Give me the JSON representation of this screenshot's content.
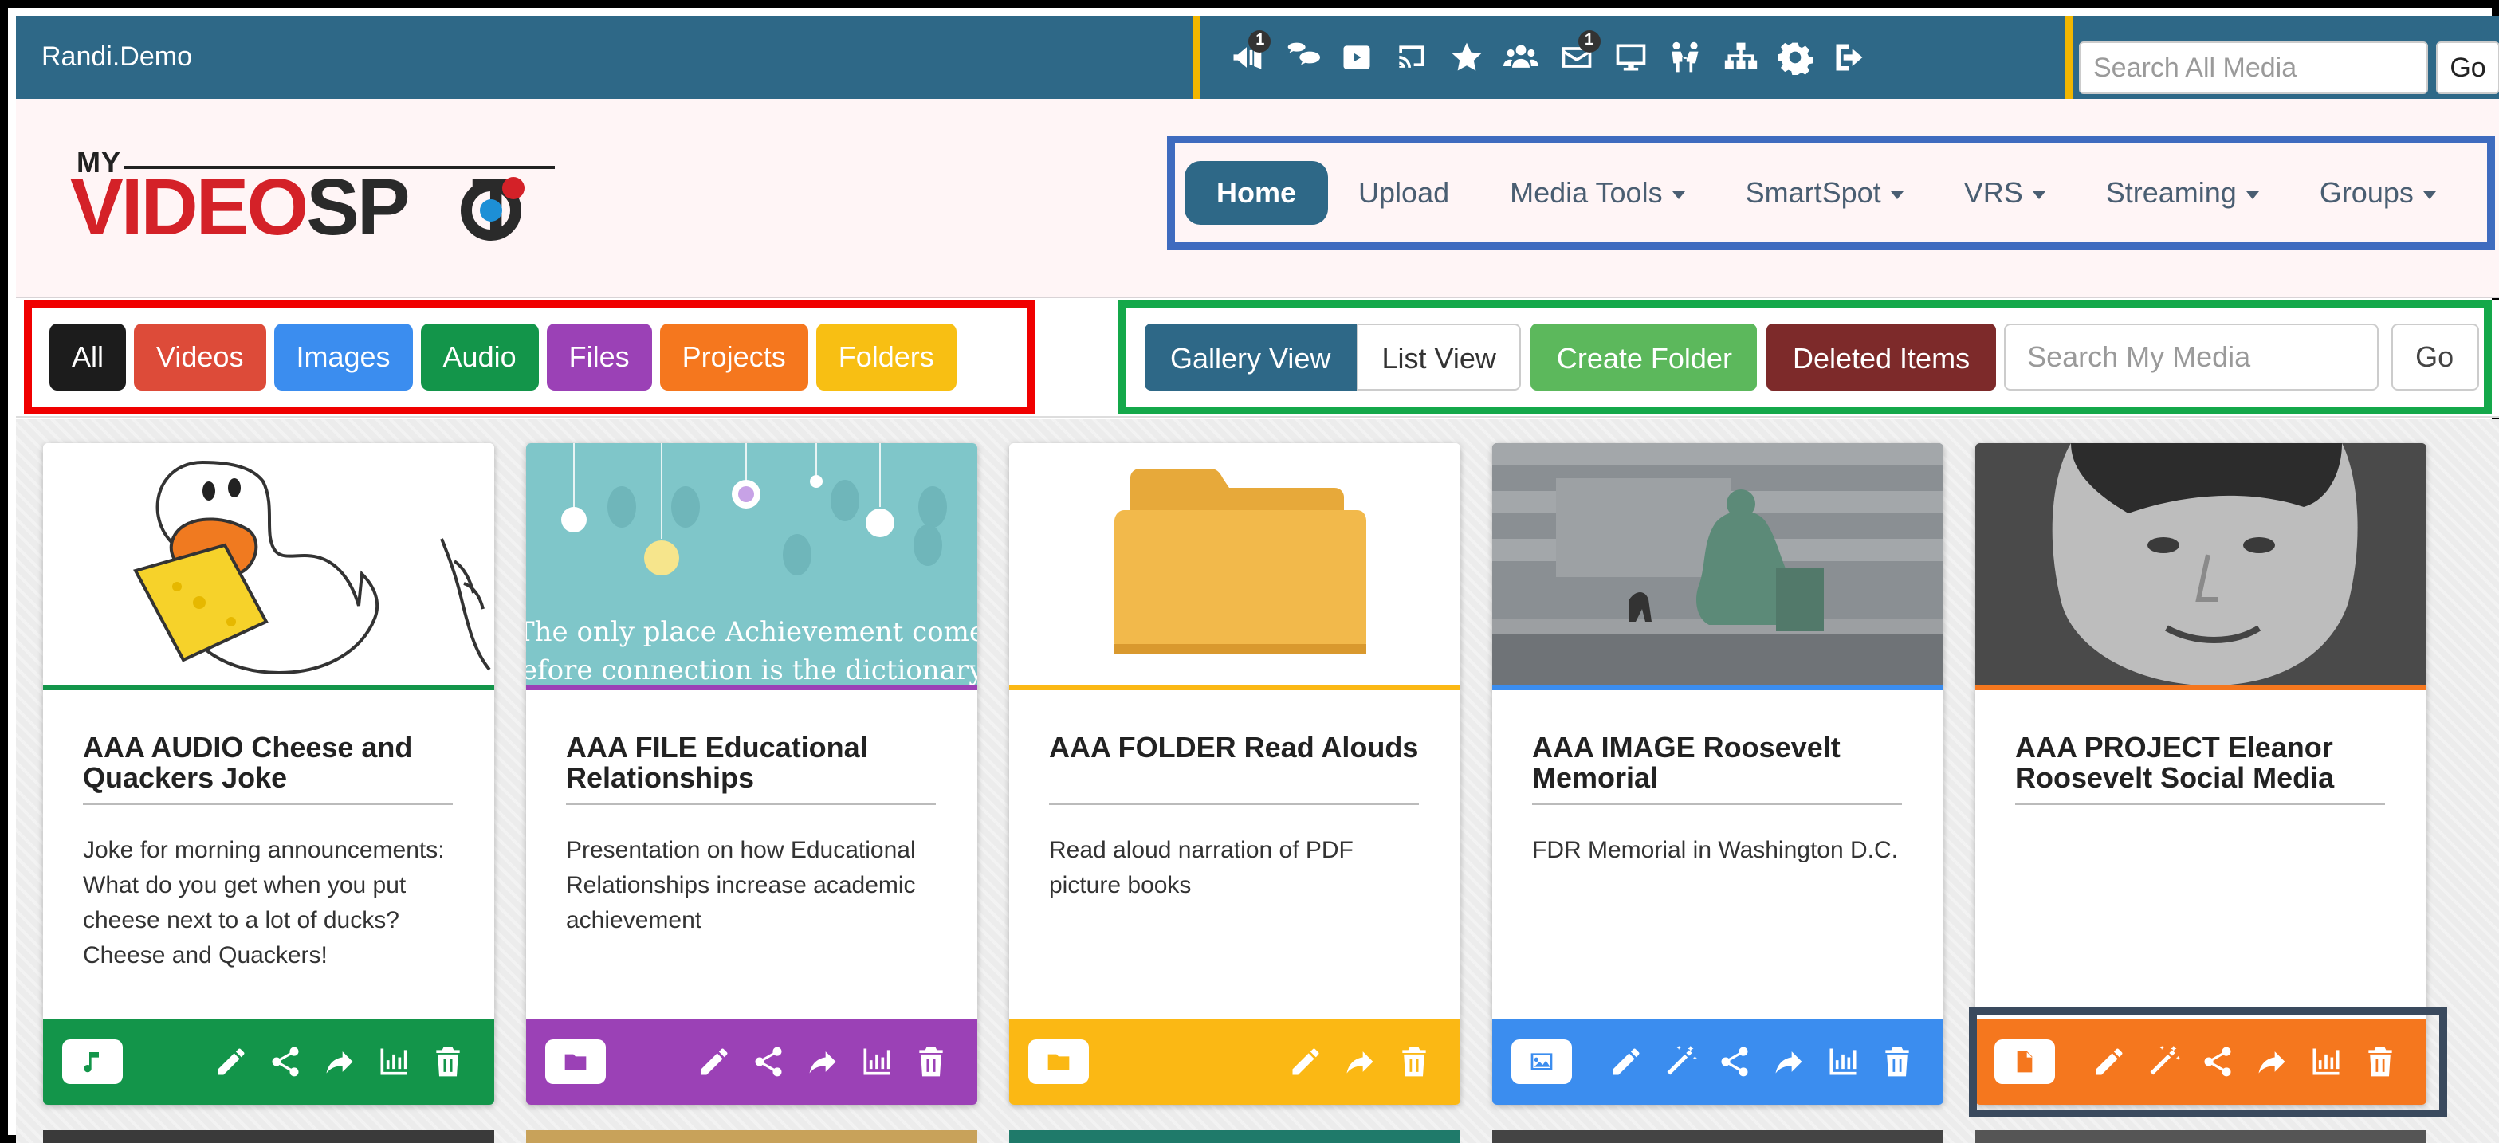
{
  "topbar": {
    "username": "Randi.Demo",
    "icons": [
      {
        "name": "announcements-icon",
        "badge": "1"
      },
      {
        "name": "chat-icon",
        "badge": ""
      },
      {
        "name": "youtube-icon",
        "badge": ""
      },
      {
        "name": "cast-icon",
        "badge": ""
      },
      {
        "name": "star-icon",
        "badge": ""
      },
      {
        "name": "users-icon",
        "badge": ""
      },
      {
        "name": "mail-icon",
        "badge": "1"
      },
      {
        "name": "monitor-icon",
        "badge": ""
      },
      {
        "name": "meeting-icon",
        "badge": ""
      },
      {
        "name": "sitemap-icon",
        "badge": ""
      },
      {
        "name": "gear-icon",
        "badge": ""
      },
      {
        "name": "logout-icon",
        "badge": ""
      }
    ],
    "search_placeholder": "Search All Media",
    "search_value": "",
    "go_label": "Go"
  },
  "logo": {
    "my": "MY",
    "video": "VIDEO",
    "spot_prefix": "SP",
    "spot_suffix": "T"
  },
  "nav": {
    "items": [
      {
        "label": "Home",
        "active": true,
        "dropdown": false
      },
      {
        "label": "Upload",
        "active": false,
        "dropdown": false
      },
      {
        "label": "Media Tools",
        "active": false,
        "dropdown": true
      },
      {
        "label": "SmartSpot",
        "active": false,
        "dropdown": true
      },
      {
        "label": "VRS",
        "active": false,
        "dropdown": true
      },
      {
        "label": "Streaming",
        "active": false,
        "dropdown": true
      },
      {
        "label": "Groups",
        "active": false,
        "dropdown": true
      }
    ]
  },
  "filters": {
    "types": [
      {
        "label": "All",
        "color": "#1c1c1c"
      },
      {
        "label": "Videos",
        "color": "#dd4b39"
      },
      {
        "label": "Images",
        "color": "#3b8def"
      },
      {
        "label": "Audio",
        "color": "#13954a"
      },
      {
        "label": "Files",
        "color": "#9b41b6"
      },
      {
        "label": "Projects",
        "color": "#f5771e"
      },
      {
        "label": "Folders",
        "color": "#f8bf13"
      }
    ],
    "views": {
      "gallery_label": "Gallery View",
      "list_label": "List View",
      "create_folder_label": "Create Folder",
      "deleted_label": "Deleted Items",
      "search_placeholder": "Search My Media",
      "search_value": "",
      "go_label": "Go"
    }
  },
  "colors": {
    "topbar": "#2e6887",
    "audio": "#13954a",
    "file": "#9b41b6",
    "folder": "#fbb814",
    "image": "#3b8def",
    "project": "#f5771e",
    "highlight_yellow": "#f2b600",
    "highlight_blue": "#3f6bbf",
    "highlight_red": "#f00000",
    "highlight_green": "#14a84a"
  },
  "cards": [
    {
      "title": "AAA AUDIO Cheese and Quackers Joke",
      "description": "Joke for morning announcements: What do you get when you put cheese next to a lot of ducks? Cheese and Quackers!",
      "type": "audio",
      "type_icon": "music-note-icon",
      "actions": [
        "pencil-icon",
        "share-icon",
        "forward-icon",
        "stats-icon",
        "trash-icon"
      ]
    },
    {
      "title": "AAA FILE Educational Relationships",
      "description": "Presentation on how Educational Relationships increase academic achievement",
      "type": "file",
      "type_icon": "folder-icon",
      "thumb_quote_line1": "“The only place Achievement comes",
      "thumb_quote_line2": "before connection is the dictionary”",
      "actions": [
        "pencil-icon",
        "share-icon",
        "forward-icon",
        "stats-icon",
        "trash-icon"
      ]
    },
    {
      "title": "AAA FOLDER Read Alouds",
      "description": "Read aloud narration of PDF picture books",
      "type": "folder",
      "type_icon": "folder-icon",
      "actions": [
        "pencil-icon",
        "forward-icon",
        "trash-icon"
      ]
    },
    {
      "title": "AAA IMAGE Roosevelt Memorial",
      "description": "FDR Memorial in Washington D.C.",
      "type": "image",
      "type_icon": "image-icon",
      "actions": [
        "pencil-icon",
        "magic-wand-icon",
        "share-icon",
        "forward-icon",
        "stats-icon",
        "trash-icon"
      ]
    },
    {
      "title": "AAA PROJECT Eleanor Roosevelt Social Media",
      "description": "",
      "type": "project",
      "type_icon": "document-icon",
      "actions": [
        "pencil-icon",
        "magic-wand-icon",
        "share-icon",
        "forward-icon",
        "stats-icon",
        "trash-icon"
      ]
    }
  ]
}
